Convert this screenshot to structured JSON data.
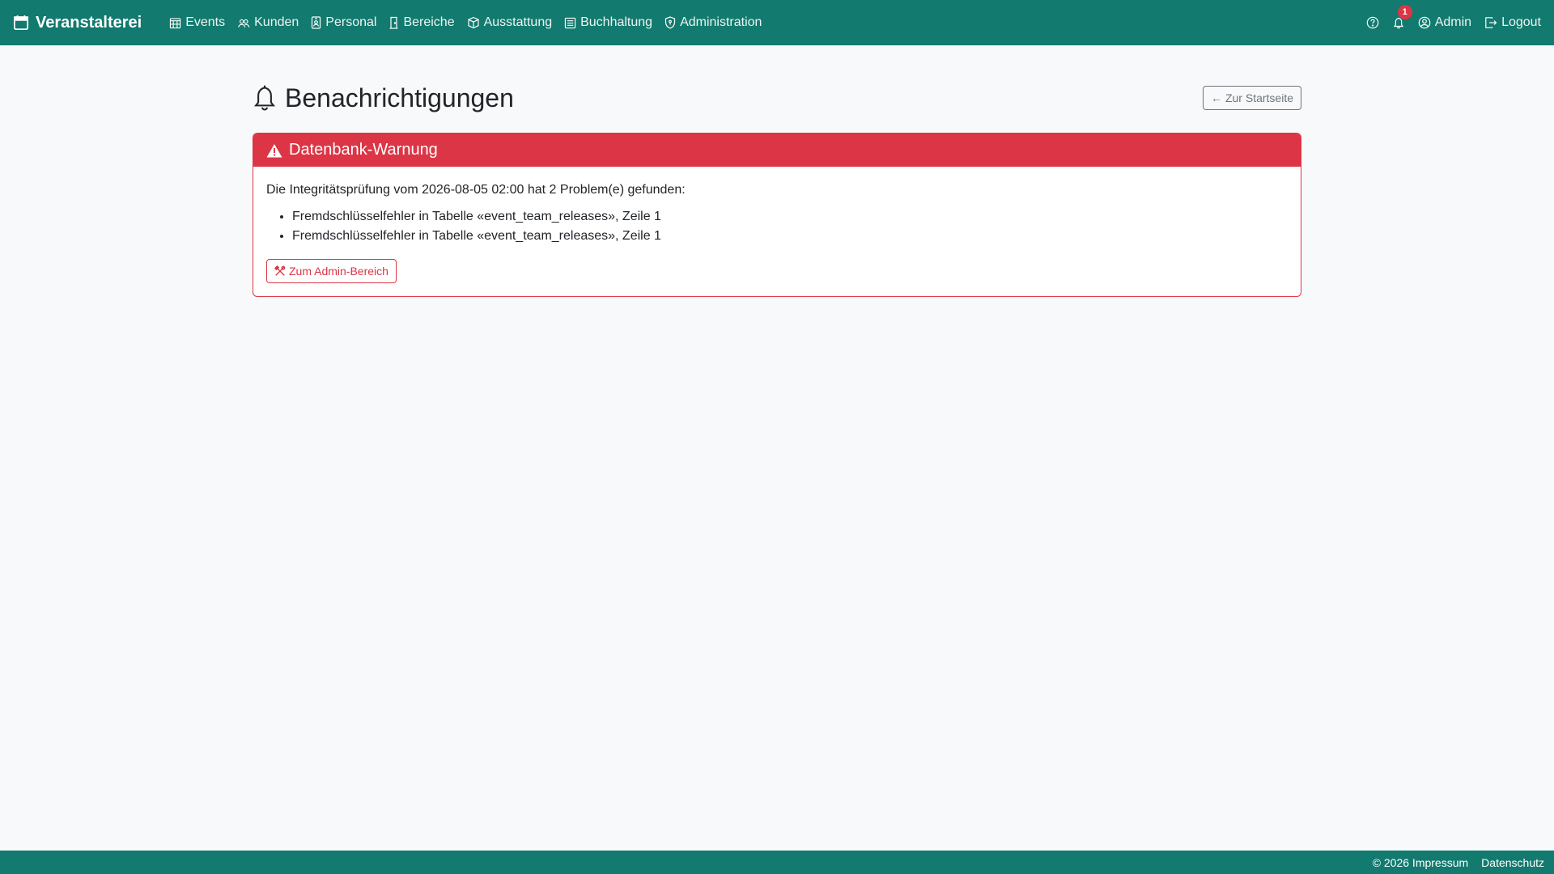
{
  "brand": {
    "name": "Veranstalterei",
    "icon": "calendar-icon"
  },
  "nav": {
    "items": [
      {
        "label": "Events",
        "icon": "calendar-grid-icon"
      },
      {
        "label": "Kunden",
        "icon": "people-icon"
      },
      {
        "label": "Personal",
        "icon": "person-badge-icon"
      },
      {
        "label": "Bereiche",
        "icon": "door-icon"
      },
      {
        "label": "Ausstattung",
        "icon": "box-icon"
      },
      {
        "label": "Buchhaltung",
        "icon": "ledger-icon"
      },
      {
        "label": "Administration",
        "icon": "shield-icon"
      }
    ],
    "notifications_count": "1",
    "user_label": "Admin",
    "logout_label": "Logout"
  },
  "page": {
    "title": "Benachrichtigungen",
    "back_label": "Zur Startseite"
  },
  "alert": {
    "title": "Datenbank-Warnung",
    "message": "Die Integritätsprüfung vom 2026-08-05 02:00 hat 2 Problem(e) gefunden:",
    "issues": [
      "Fremdschlüsselfehler in Tabelle «event_team_releases», Zeile 1",
      "Fremdschlüsselfehler in Tabelle «event_team_releases», Zeile 1"
    ],
    "action_label": "Zum Admin-Bereich"
  },
  "footer": {
    "copyright": "© 2026 Impressum",
    "privacy": "Datenschutz"
  },
  "colors": {
    "primary": "#127a6e",
    "danger": "#dc3545",
    "background": "#f8f9fa"
  }
}
